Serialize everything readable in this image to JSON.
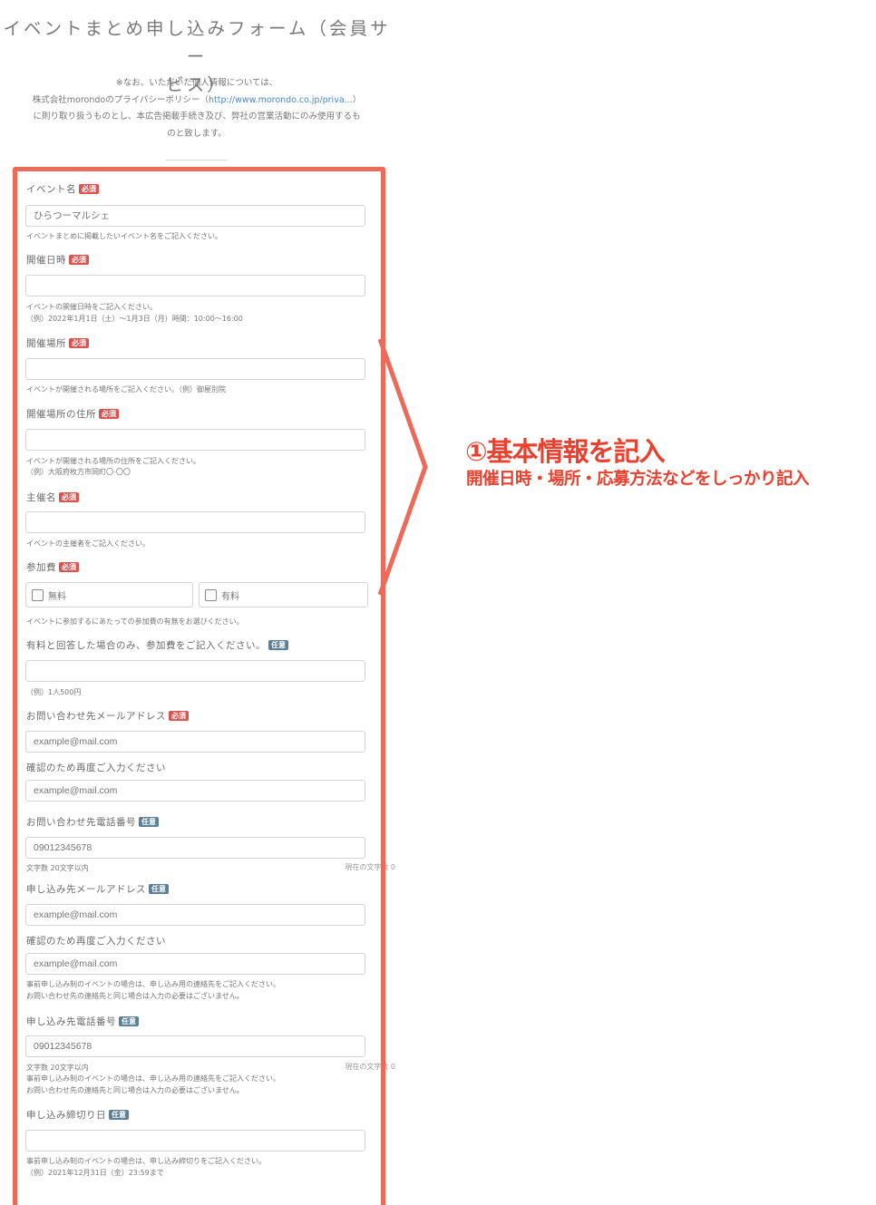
{
  "form": {
    "title_line1": "イベントまとめ申し込みフォーム（会員サー",
    "title_line2": "ビス）",
    "notice_line1": "※なお、いただいた個人情報については、",
    "notice_line2_prefix": "株式会社morondoのプライバシーポリシー（",
    "notice_link": "http://www.morondo.co.jp/priva...",
    "notice_line2_suffix": "）",
    "notice_line3": "に則り取り扱うものとし、本広告掲載手続き及び、弊社の営業活動にのみ使用するも",
    "notice_line4": "のと致します。"
  },
  "badges": {
    "required": "必須",
    "optional": "任意"
  },
  "fields": {
    "event_name": {
      "label": "イベント名",
      "placeholder": "ひらつーマルシェ",
      "help": "イベントまとめに掲載したいイベント名をご記入ください。"
    },
    "event_datetime": {
      "label": "開催日時",
      "help1": "イベントの開催日時をご記入ください。",
      "help2": "（例）2022年1月1日（土）～1月3日（月）時間：10:00～16:00"
    },
    "venue": {
      "label": "開催場所",
      "help": "イベントが開催される場所をご記入ください。（例）御屋別院"
    },
    "venue_address": {
      "label": "開催場所の住所",
      "help1": "イベントが開催される場所の住所をご記入ください。",
      "help2": "（例）大阪府枚方市岡町〇-〇〇"
    },
    "organizer": {
      "label": "主催名",
      "help": "イベントの主催者をご記入ください。"
    },
    "fee": {
      "label": "参加費",
      "option_free": "無料",
      "option_paid": "有料",
      "help": "イベントに参加するにあたっての参加費の有無をお選びください。"
    },
    "fee_amount": {
      "label": "有料と回答した場合のみ、参加費をご記入ください。",
      "help": "（例）1人500円"
    },
    "contact_email": {
      "label": "お問い合わせ先メールアドレス",
      "placeholder": "example@mail.com",
      "confirm_label": "確認のため再度ご入力ください",
      "confirm_placeholder": "example@mail.com"
    },
    "contact_phone": {
      "label": "お問い合わせ先電話番号",
      "placeholder": "09012345678",
      "limit": "文字数 20文字以内",
      "current": "現在の文字数 0"
    },
    "apply_email": {
      "label": "申し込み先メールアドレス",
      "placeholder": "example@mail.com",
      "confirm_label": "確認のため再度ご入力ください",
      "confirm_placeholder": "example@mail.com",
      "help1": "事前申し込み制のイベントの場合は、申し込み用の連絡先をご記入ください。",
      "help2": "お問い合わせ先の連絡先と同じ場合は入力の必要はございません。"
    },
    "apply_phone": {
      "label": "申し込み先電話番号",
      "placeholder": "09012345678",
      "limit": "文字数 20文字以内",
      "current": "現在の文字数 0",
      "help1": "事前申し込み制のイベントの場合は、申し込み用の連絡先をご記入ください。",
      "help2": "お問い合わせ先の連絡先と同じ場合は入力の必要はございません。"
    },
    "apply_deadline": {
      "label": "申し込み締切り日",
      "help1": "事前申し込み制のイベントの場合は、申し込み締切りをご記入ください。",
      "help2": "（例）2021年12月31日（金）23:59まで"
    }
  },
  "annotation": {
    "title": "①基本情報を記入",
    "subtitle": "開催日時・場所・応募方法などをしっかり記入",
    "color": "#e8412f",
    "frame_color": "#ec6a5a"
  }
}
